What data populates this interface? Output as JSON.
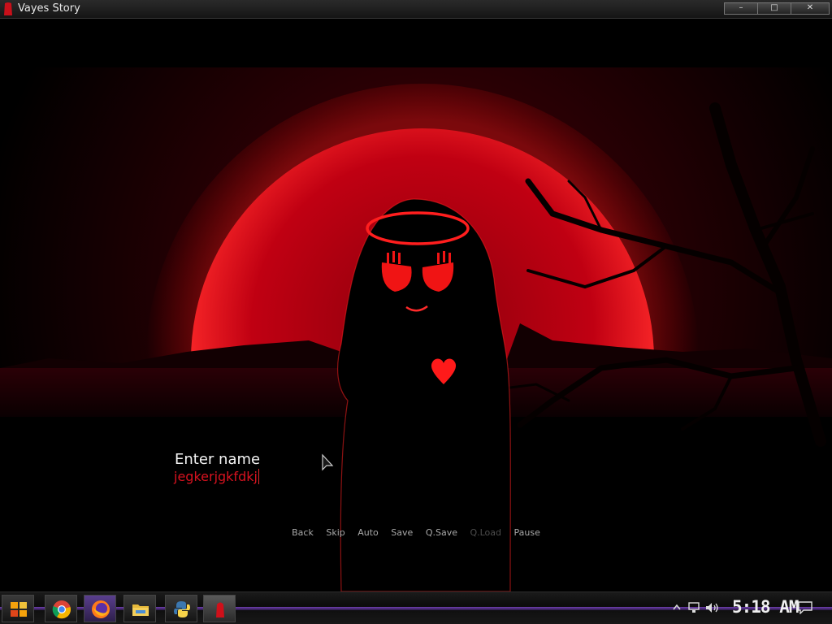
{
  "window": {
    "title": "Vayes Story",
    "minimize_glyph": "–",
    "maximize_glyph": "□",
    "close_glyph": "✕"
  },
  "dialog": {
    "prompt": "Enter name",
    "input_value": "jegkerjgkfdkj"
  },
  "quick_menu": {
    "back": "Back",
    "skip": "Skip",
    "auto": "Auto",
    "save": "Save",
    "qsave": "Q.Save",
    "qload": "Q.Load",
    "pause": "Pause"
  },
  "taskbar": {
    "clock": "5:18 AM",
    "apps": [
      "start-icon",
      "chrome-icon",
      "firefox-icon",
      "file-explorer-icon",
      "python-icon",
      "vayes-story-icon"
    ],
    "tray_icons": [
      "chevron-up-icon",
      "network-icon",
      "speaker-icon",
      "notification-icon"
    ]
  },
  "colors": {
    "accent_red": "#d8121f",
    "moon_red": "#b00010",
    "taskbar_purple": "#6e3fae"
  }
}
